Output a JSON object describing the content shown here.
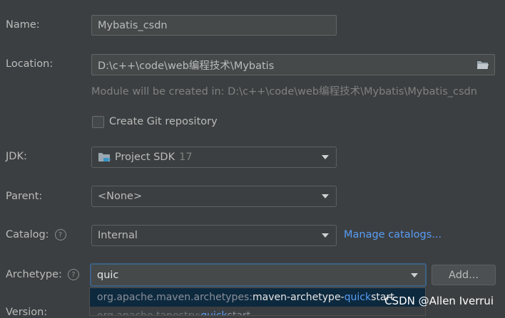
{
  "name": {
    "label": "Name:",
    "value": "Mybatis_csdn"
  },
  "location": {
    "label": "Location:",
    "value": "D:\\c++\\code\\web编程技术\\Mybatis",
    "hint": "Module will be created in: D:\\c++\\code\\web编程技术\\Mybatis\\Mybatis_csdn",
    "icon": "folder-icon"
  },
  "git": {
    "label": "Create Git repository",
    "checked": false
  },
  "jdk": {
    "label": "JDK:",
    "value": "Project SDK",
    "version": "17",
    "icon": "folder-java-icon"
  },
  "parent": {
    "label": "Parent:",
    "value": "<None>"
  },
  "catalog": {
    "label": "Catalog:",
    "value": "Internal",
    "link": "Manage catalogs..."
  },
  "archetype": {
    "label": "Archetype:",
    "value": "quic",
    "add_button": "Add...",
    "suggestions": [
      {
        "prefix": "org.apache.maven.archetypes:",
        "name": "maven-archetype-",
        "match": "quick",
        "rest": "start"
      },
      {
        "prefix": "org.apache.tapestry:",
        "name": "",
        "match": "quick",
        "rest": "start"
      }
    ]
  },
  "version": {
    "label": "Version:"
  },
  "watermark": "CSDN @Allen Iverrui",
  "colors": {
    "background": "#3c3f41",
    "field": "#45494a",
    "link": "#589df6",
    "selection": "#0d293e",
    "focus_border": "#3d6185"
  }
}
